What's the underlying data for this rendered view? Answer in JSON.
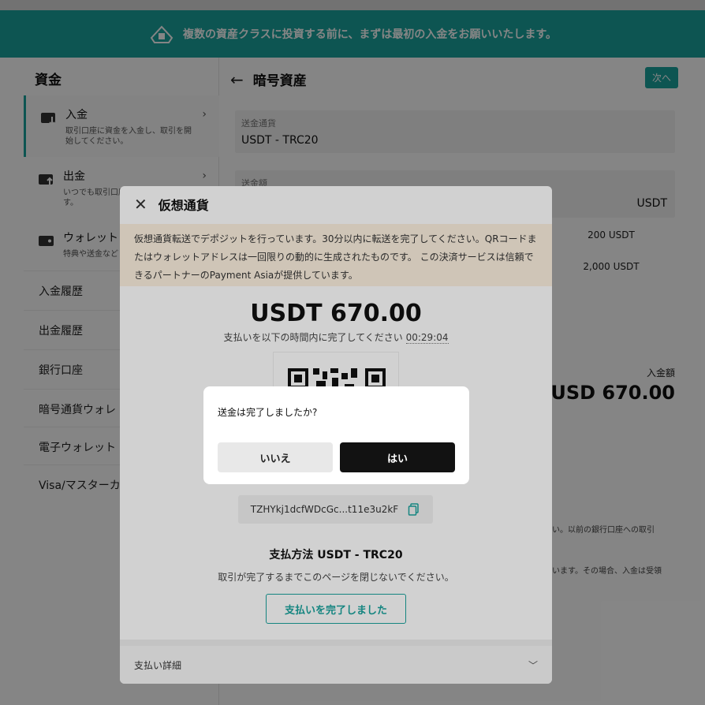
{
  "banner": {
    "text": "複数の資産クラスに投資する前に、まずは最初の入金をお願いいたします。"
  },
  "sidebar": {
    "title": "資金",
    "cards": [
      {
        "title": "入金",
        "subtitle": "取引口座に資金を入金し、取引を開始してください。"
      },
      {
        "title": "出金",
        "subtitle": "いつでも取引口座から出金できます。"
      },
      {
        "title": "ウォレット",
        "subtitle": "特典や送金など"
      }
    ],
    "links": [
      "入金履歴",
      "出金履歴",
      "銀行口座",
      "暗号通貨ウォレ",
      "電子ウォレット",
      "Visa/マスターカ"
    ]
  },
  "main": {
    "back_title": "暗号資産",
    "next_button": "次へ",
    "currency_field": {
      "label": "送金通貨",
      "value": "USDT - TRC20"
    },
    "amount_field": {
      "label": "送金額",
      "unit": "USDT"
    },
    "amount_options": [
      "200 USDT",
      "2,000 USDT"
    ],
    "deposit_label": "入金額",
    "deposit_amount": "USD 670.00",
    "note1": "い。以前の銀行口座への取引",
    "note2": "います。その場合、入金は受領"
  },
  "crypto_modal": {
    "title": "仮想通貨",
    "notice": "仮想通貨転送でデポジットを行っています。30分以内に転送を完了してください。QRコードまたはウォレットアドレスは一回限りの動的に生成されたものです。 この決済サービスは信頼できるパートナーのPayment Asiaが提供しています。",
    "amount": "USDT 670.00",
    "timer_prefix": "支払いを以下の時間内に完了してください",
    "timer_value": "00:29:04",
    "address": "TZHYkj1dcfWDcGc...t11e3u2kF",
    "pay_method": "支払方法 USDT - TRC20",
    "warning": "取引が完了するまでこのページを閉じないでください。",
    "paid_button": "支払いを完了しました",
    "details_label": "支払い詳細"
  },
  "confirm_dialog": {
    "question": "送金は完了しましたか?",
    "no_label": "いいえ",
    "yes_label": "はい"
  },
  "colors": {
    "accent": "#1aa39d",
    "dark_button": "#121212",
    "notice_bg": "#fdf1e0"
  }
}
